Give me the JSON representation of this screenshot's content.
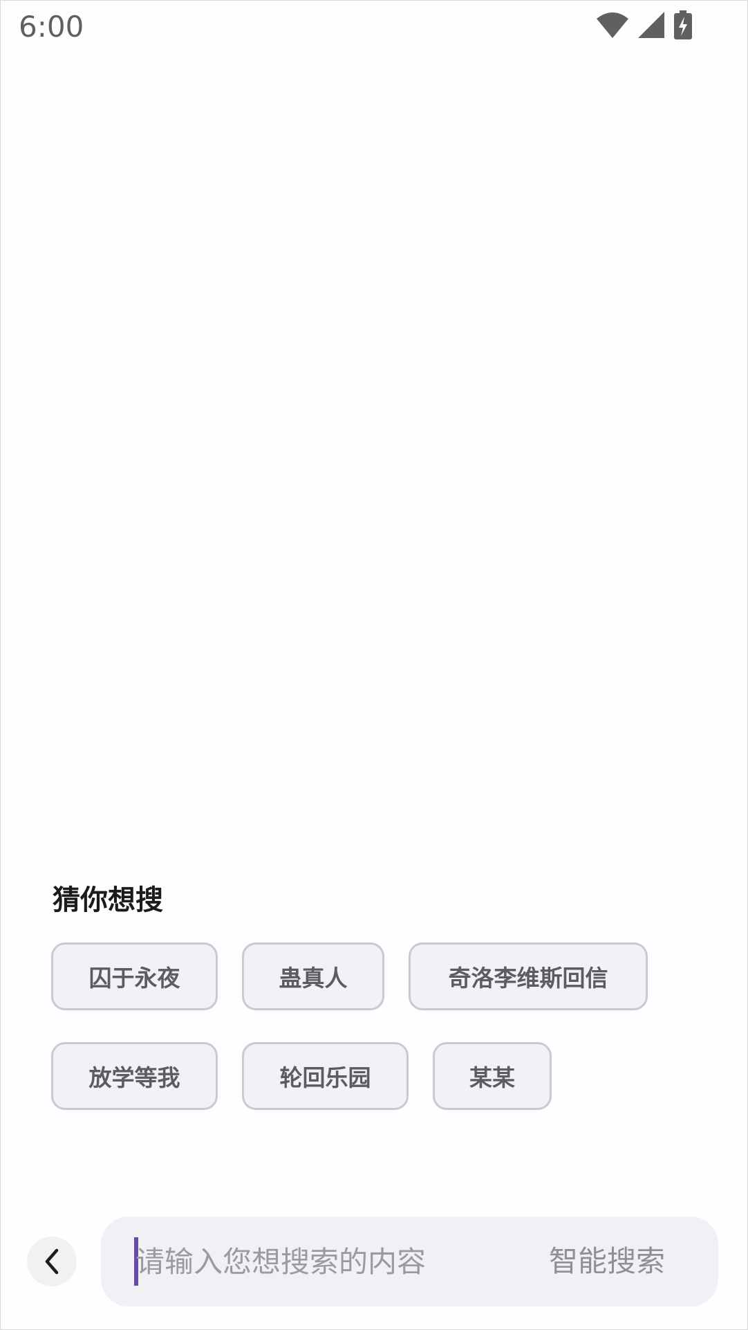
{
  "status_bar": {
    "time": "6:00",
    "icons": [
      "wifi-icon",
      "cell-signal-icon",
      "battery-charging-icon"
    ]
  },
  "suggestions": {
    "title": "猜你想搜",
    "chips": [
      "囚于永夜",
      "蛊真人",
      "奇洛李维斯回信",
      "放学等我",
      "轮回乐园",
      "某某"
    ]
  },
  "search": {
    "placeholder": "请输入您想搜索的内容",
    "action_label": "智能搜索",
    "cursor_color": "#6a49a8"
  },
  "nav": {
    "back_icon": "chevron-left-icon"
  }
}
